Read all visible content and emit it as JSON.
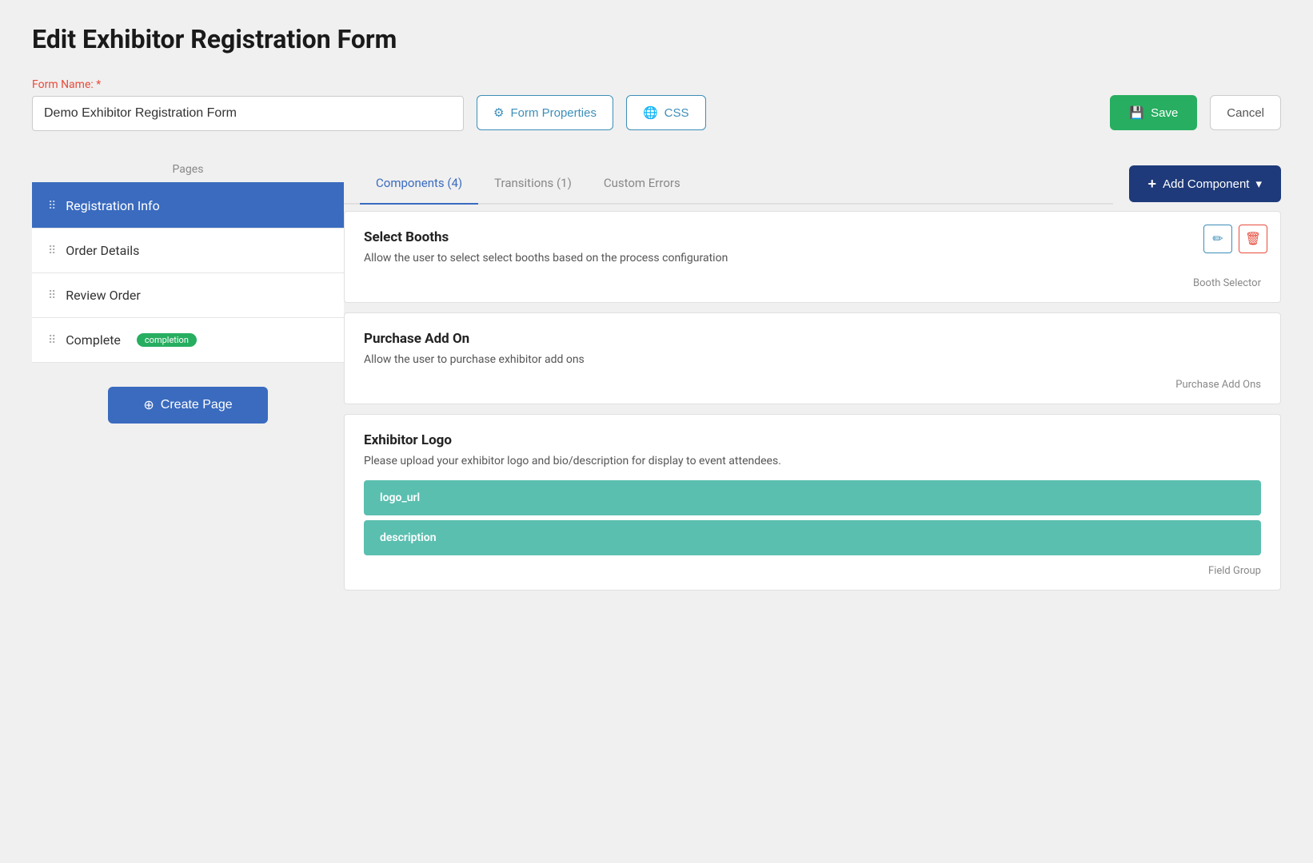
{
  "page": {
    "title": "Edit Exhibitor Registration Form"
  },
  "header": {
    "form_name_label": "Form Name:",
    "form_name_required": "*",
    "form_name_value": "Demo Exhibitor Registration Form",
    "form_properties_label": "Form Properties",
    "css_label": "CSS",
    "save_label": "Save",
    "cancel_label": "Cancel"
  },
  "sidebar": {
    "pages_label": "Pages",
    "items": [
      {
        "id": "registration-info",
        "label": "Registration Info",
        "active": true,
        "badge": null
      },
      {
        "id": "order-details",
        "label": "Order Details",
        "active": false,
        "badge": null
      },
      {
        "id": "review-order",
        "label": "Review Order",
        "active": false,
        "badge": null
      },
      {
        "id": "complete",
        "label": "Complete",
        "active": false,
        "badge": "completion"
      }
    ],
    "create_page_label": "Create Page"
  },
  "main": {
    "add_component_label": "Add Component",
    "tabs": [
      {
        "id": "components",
        "label": "Components (4)",
        "active": true
      },
      {
        "id": "transitions",
        "label": "Transitions (1)",
        "active": false
      },
      {
        "id": "custom-errors",
        "label": "Custom Errors",
        "active": false
      }
    ],
    "components": [
      {
        "id": "select-booths",
        "title": "Select Booths",
        "description": "Allow the user to select select booths based on the process configuration",
        "type": "Booth Selector",
        "has_actions": true,
        "fields": []
      },
      {
        "id": "purchase-add-on",
        "title": "Purchase Add On",
        "description": "Allow the user to purchase exhibitor add ons",
        "type": "Purchase Add Ons",
        "has_actions": false,
        "fields": []
      },
      {
        "id": "exhibitor-logo",
        "title": "Exhibitor Logo",
        "description": "Please upload your exhibitor logo and bio/description for display to event attendees.",
        "type": "Field Group",
        "has_actions": false,
        "fields": [
          "logo_url",
          "description"
        ]
      }
    ]
  },
  "icons": {
    "gear": "⚙",
    "css": "🌐",
    "save": "💾",
    "dots": "⠿",
    "plus": "+",
    "pencil": "✏",
    "trash": "🗑",
    "chevron_down": "▾",
    "circle_plus": "⊕"
  }
}
